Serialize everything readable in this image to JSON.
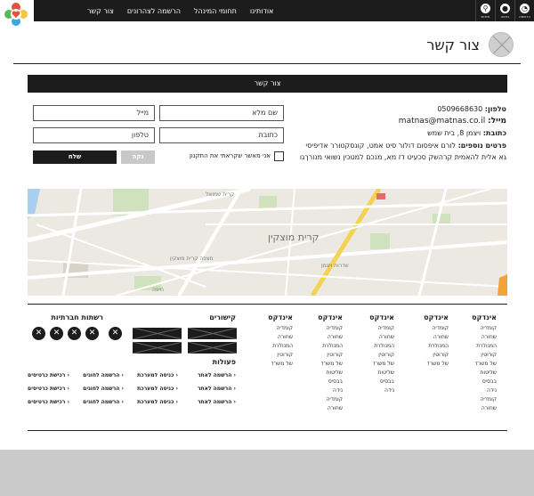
{
  "topbar": {
    "icons": [
      {
        "name": "registration-icon",
        "label": "הרשמה"
      },
      {
        "name": "login-icon",
        "label": "כניסה"
      },
      {
        "name": "search-icon",
        "label": "חיפוש"
      }
    ],
    "nav": [
      "אודותינו",
      "תחומי המינהל",
      "הרשמה לצהרונים",
      "צור קשר"
    ]
  },
  "page": {
    "title": "צור קשר"
  },
  "section": {
    "title": "צור קשר"
  },
  "info": {
    "phone_label": "טלפון:",
    "phone": "0509668630",
    "email_label": "מייל:",
    "email": "matnas@matnas.co.il",
    "address_label": "כתובת:",
    "address": "ויצמן 8, בית שמש",
    "more_label": "פרטים נוספים:",
    "more_line1": "לורם איפסום דולור סיט אמט, קונסקטורר אדיפיסי",
    "more_line2": "גא אלית להאמית קרהשק סכעיט דז מא, מנכם למטכין נשואי מנורךגו"
  },
  "form": {
    "fullname": "שם מלא",
    "email": "מייל",
    "address": "כתובת",
    "phone": "טלפון",
    "consent": "אני מאשר שקראתי את התקנון",
    "send": "שלח",
    "clear": "נקה"
  },
  "map": {
    "labels": [
      "קרית מוצקין",
      "שדרות ויצמן",
      "מצפה קרית מוצקין",
      "קרית שמואל",
      "חיפה"
    ]
  },
  "footer": {
    "columns": [
      {
        "title": "אינדקס",
        "items": [
          "קומדיה",
          "שחורה",
          "המנולרת",
          "קורוטין",
          "של משרד",
          "שליטות",
          "בבסיס",
          "נידה",
          "קומדיה",
          "שחורה"
        ]
      },
      {
        "title": "אינדקס",
        "items": [
          "קומדיה",
          "שחורה",
          "המנולרת",
          "קורוטין",
          "של משרד"
        ]
      },
      {
        "title": "אינדקס",
        "items": [
          "קומדיה",
          "שחורה",
          "המנולרת",
          "קורוטין",
          "של משרד",
          "שליטות",
          "בבסיס",
          "נידה"
        ]
      },
      {
        "title": "אינדקס",
        "items": [
          "קומדיה",
          "שחורה",
          "המנולרת",
          "קורוטין",
          "של משרד",
          "שליטות",
          "בבסיס",
          "נידה",
          "קומדיה",
          "שחורה"
        ]
      },
      {
        "title": "אינדקס",
        "items": [
          "קומדיה",
          "שחורה",
          "המנולרת",
          "קורוטין",
          "של משרד"
        ]
      }
    ],
    "links_title": "קישורים",
    "social_title": "רשתות חברתיות",
    "actions_title": "פעולות",
    "actions": [
      [
        "הרשמה לאתר",
        "כניסה למערכת",
        "הרשמה לחוגים",
        "רכישת כרטיסים"
      ],
      [
        "הרשמה לאתר",
        "כניסה למערכת",
        "הרשמה לחוגים",
        "רכישת כרטיסים"
      ],
      [
        "הרשמה לאתר",
        "כניסה למערכת",
        "הרשמה לחוגים",
        "רכישת כרטיסים"
      ]
    ],
    "chevron": "‹"
  }
}
